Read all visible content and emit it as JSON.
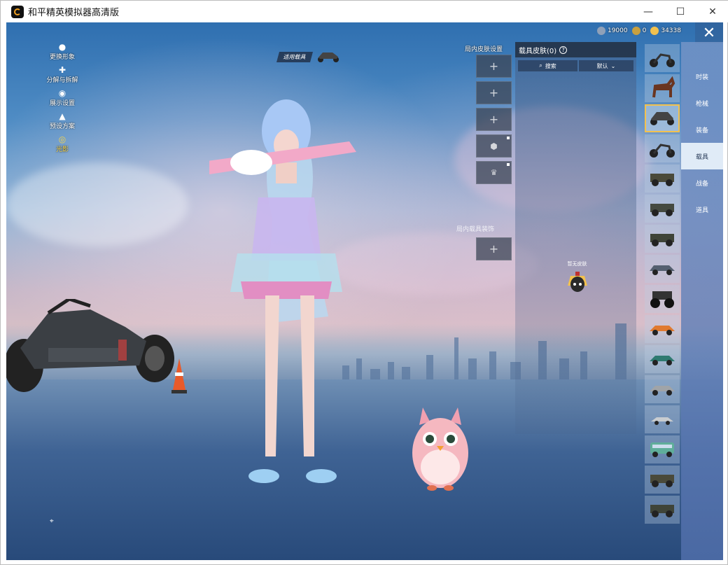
{
  "window": {
    "title": "和平精英模拟器高清版",
    "minimize": "—",
    "maximize": "☐",
    "close": "✕"
  },
  "left_menu": {
    "items": [
      {
        "label": "更换形象",
        "icon": "avatar-icon"
      },
      {
        "label": "分解与拆解",
        "icon": "puzzle-icon"
      },
      {
        "label": "展示设置",
        "icon": "eye-icon"
      },
      {
        "label": "预设方案",
        "icon": "flame-icon"
      },
      {
        "label": "光影",
        "icon": "badge-icon",
        "active": true
      }
    ]
  },
  "currency": [
    {
      "value": "19000",
      "icon": "coupon-icon"
    },
    {
      "value": "0",
      "icon": "token-icon"
    },
    {
      "value": "34338",
      "icon": "gold-icon"
    }
  ],
  "vehicle_tag": {
    "label": "适用载具"
  },
  "slots": {
    "title": "局内皮肤设置",
    "title2": "局内载具装饰",
    "plus": "+"
  },
  "skin_panel": {
    "title": "载具皮肤(0)",
    "help": "?",
    "search_label": "搜索",
    "sort_label": "默认",
    "no_skin_label": "暂无皮肤"
  },
  "categories": [
    {
      "label": "时装"
    },
    {
      "label": "枪械"
    },
    {
      "label": "装备"
    },
    {
      "label": "载具",
      "active": true
    },
    {
      "label": "战备"
    },
    {
      "label": "道具"
    }
  ],
  "colors": {
    "accent_gold": "#f2c14e",
    "panel_dark": "#1e2837",
    "tab_active": "#e6f0fa"
  }
}
